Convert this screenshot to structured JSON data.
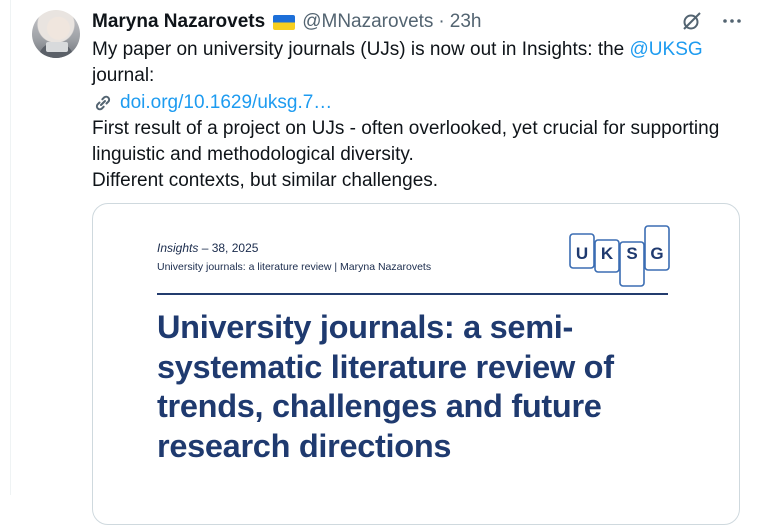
{
  "tweet": {
    "author_name": "Maryna Nazarovets",
    "flag_icon": "ukraine-flag-icon",
    "handle": "@MNazarovets",
    "separator": "·",
    "time": "23h",
    "actions": {
      "grok_icon": "grok-icon",
      "more_icon": "more-icon"
    },
    "text": {
      "line1_prefix": "My paper on university journals (UJs) is now out in Insights: the ",
      "mention": "@UKSG",
      "line2": "journal:",
      "link": "doi.org/10.1629/uksg.7…",
      "line4": "First result of a project on UJs - often overlooked, yet crucial for supporting linguistic and methodological diversity.",
      "line5": "Different contexts, but similar challenges."
    },
    "colors": {
      "accent": "#1d9bf0",
      "secondary_text": "#536471",
      "doc_title": "#1f3a6f"
    }
  },
  "card": {
    "journal_italic": "Insights",
    "journal_rest": " – 38, 2025",
    "review_line": "University journals: a literature review | Maryna Nazarovets",
    "logo_letters": [
      "U",
      "K",
      "S",
      "G"
    ],
    "title": "University journals: a semi-systematic literature review of trends, challenges and future research directions"
  }
}
